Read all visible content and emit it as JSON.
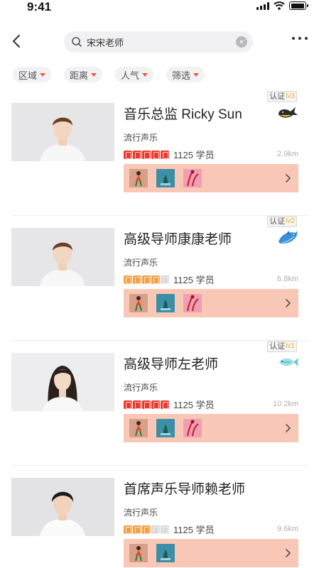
{
  "status_bar": {
    "time": "9:41",
    "battery_level": 0.95
  },
  "search": {
    "value": "宋宋老师",
    "placeholder": "宋宋老师"
  },
  "filters": [
    {
      "label": "区域"
    },
    {
      "label": "距离"
    },
    {
      "label": "人气"
    },
    {
      "label": "筛选"
    }
  ],
  "colors": {
    "accent": "#f05a3a",
    "works_bar": "#f9c7b6",
    "badge_level": "#f0b429"
  },
  "teachers": [
    {
      "badge": "认证",
      "level": "lv3",
      "name": "音乐总监 Ricky Sun",
      "genre": "流行声乐",
      "rating": {
        "red": 5,
        "orange": 0,
        "grey": 0
      },
      "students": "1125 学员",
      "distance": "2.9km",
      "level_icon": "whale-icon",
      "works": [
        "dancer-thumbnail",
        "fountain-thumbnail",
        "flower-thumbnail"
      ]
    },
    {
      "badge": "认证",
      "level": "lv2",
      "name": "高级导师康康老师",
      "genre": "流行声乐",
      "rating": {
        "red": 0,
        "orange": 4,
        "grey": 1
      },
      "students": "1125 学员",
      "distance": "6.8km",
      "level_icon": "dolphin-icon",
      "works": [
        "dancer-thumbnail",
        "fountain-thumbnail",
        "flower-thumbnail"
      ]
    },
    {
      "badge": "认证",
      "level": "lv1",
      "name": "高级导师左老师",
      "genre": "流行声乐",
      "rating": {
        "red": 5,
        "orange": 0,
        "grey": 0
      },
      "students": "1125 学员",
      "distance": "10.2km",
      "level_icon": "fish-icon",
      "works": [
        "dancer-thumbnail",
        "fountain-thumbnail",
        "flower-thumbnail"
      ]
    },
    {
      "badge": "",
      "level": "",
      "name": "首席声乐导师赖老师",
      "genre": "流行声乐",
      "rating": {
        "red": 0,
        "orange": 3,
        "grey": 2
      },
      "students": "1125 学员",
      "distance": "9.6km",
      "level_icon": "",
      "works": [
        "dancer-thumbnail",
        "fountain-thumbnail"
      ]
    }
  ]
}
